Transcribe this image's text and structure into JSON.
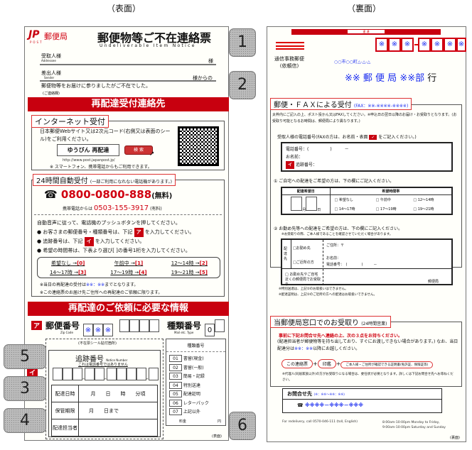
{
  "labels": {
    "front": "（表面）",
    "back": "（裏面）"
  },
  "front": {
    "logo": "JP",
    "logo_sub": "POST",
    "brand": "郵便局",
    "title": "郵便物等ご不在連絡票",
    "subtitle": "Undeliverable Item Notice",
    "addressee": "受取人様",
    "addressee_en": "Addressee",
    "addressee_suffix": "様",
    "sender": "差出人様",
    "sender_en": "Sender",
    "sender_suffix": "様からの",
    "message": "郵便物等をお届けに参りましたがご不在でした。",
    "contact_note": "(ご連絡欄)",
    "band1": "再配達受付連絡先",
    "internet": {
      "title": "インターネット受付",
      "desc": "日本郵便Webサイト又は2次元コード(右側又は表面のシール)をご利用ください。",
      "search_term": "ゆうびん 再配達",
      "search_button": "検 索",
      "url": "http://www.post.japanpost.jp/",
      "note": "※ スマートフォン、携帯電話からもご利用できます。"
    },
    "auto": {
      "title": "24時間自動受付",
      "title_note": "(一部ご利用になれない電話機があります。)",
      "phone_icon": "☎",
      "phone": "0800-0800-888",
      "phone_free": "(無料)",
      "mobile_label": "携帯電話からは",
      "mobile": "0503-155-3917",
      "mobile_paid": "(有料)",
      "lines": [
        "自動音声に従って、電話機のプッシュボタンを押してください。"
      ],
      "bullet1a": "お客さまの郵便番号・種類番号は、下記",
      "bullet1b": "を入力してください。",
      "bullet2a": "追跡番号は、下記",
      "bullet2b": "を入力してください。",
      "bullet3": "希望の時間帯は、下表より選び[ ]の番号1桁を入力してください。",
      "times": [
        {
          "t": "希望なし →",
          "n": "[0]"
        },
        {
          "t": "午前中 →",
          "n": "[1]"
        },
        {
          "t": "12〜14時 →",
          "n": "[2]"
        },
        {
          "t": "14〜17時 →",
          "n": "[3]"
        },
        {
          "t": "17〜19時 →",
          "n": "[4]"
        },
        {
          "t": "19〜21時 →",
          "n": "[5]"
        }
      ],
      "note1a": "※当日の再配達の受付は",
      "note1b": "※※：※※",
      "note1c": "までとなります。",
      "note2": "※この連絡票のお届け先ご住所への再配達のご依頼に限ります。"
    },
    "band2": "再配達のご依頼に必要な情報",
    "tag_a": "ア",
    "tag_i": "イ",
    "zip": {
      "label": "郵便番号",
      "en": "Zip Code",
      "cells": [
        "※",
        "※",
        "※"
      ]
    },
    "type": {
      "label": "種類番号",
      "en": "Mail etc. Type",
      "value": "0"
    },
    "seal_note": "(不在票シール貼付箇所)",
    "tracking": {
      "label": "追跡番号",
      "en": "Notice Number",
      "note": "これは電話番号ではありません"
    },
    "rows": [
      {
        "label": "配達日時",
        "value": "月　　日　　時　　分頃"
      },
      {
        "label": "保管期限",
        "value": "月　　日まで"
      },
      {
        "label": "配達担当者",
        "value": ""
      }
    ],
    "types_title": "種類番号",
    "types": [
      {
        "code": "01",
        "name": "書留(現金)"
      },
      {
        "code": "02",
        "name": "書留(一般)"
      },
      {
        "code": "03",
        "name": "簡易・記録"
      },
      {
        "code": "04",
        "name": "特別送達"
      },
      {
        "code": "05",
        "name": "配達証明"
      },
      {
        "code": "06",
        "name": "レターパック"
      },
      {
        "code": "07",
        "name": "上記以外"
      }
    ],
    "fee_label": "料金",
    "fee_unit": "円",
    "side": "(表面)"
  },
  "callouts": [
    "1",
    "2",
    "3",
    "4",
    "5",
    "6"
  ],
  "back": {
    "top_bar": "速 達",
    "postal": [
      "※",
      "※",
      "※",
      "※",
      "※",
      "※",
      "※"
    ],
    "mail_type": "通信事務郵便",
    "mail_type2": "(依頼信)",
    "address": "○○市○○町△-△-△",
    "office": "※※ 郵 便 局",
    "dept": "※※部",
    "to": "行",
    "fax": {
      "title": "郵便・ＦＡＸによる受付",
      "fax_no": "(FAX：※※-※※※※-※※※※)",
      "desc": "太枠内にご記入の上、ポスト投かん又はFAXしてください。※申込日の翌日以降のお届け・お受取りとなります。(お受取り可能となるお時間は、郵便局により異なります。)",
      "phone_title_a": "受取人様の電話番号(FAXの方は、お名前・表面",
      "phone_title_b": "をご記入ください。)",
      "check": "✓",
      "phone": "電話番号：(　　　　　)　　　－",
      "name": "お名前：",
      "tracking": "追跡番号：",
      "q1": "① ご自宅への配達をご希望の方は、下の欄にご記入ください。",
      "date_h": "配達希望日",
      "time_h": "希望時間帯",
      "month": "月",
      "day": "日",
      "slots": [
        "□ 希望なし",
        "□ 午前中",
        "□ 12〜14時",
        "□ 14〜17時",
        "□ 17〜19時",
        "□ 19〜21時"
      ],
      "q2": "② お勤め先等への配達をご希望の方は、下の欄にご記入ください。",
      "q2_note": "※お受取りの際、ご本人様であることを確認させていただく場合があります。",
      "dest": "配達先",
      "opt1": "□お勤め先",
      "opt2": "□ご近所の方",
      "addr": "ご住所：〒",
      "name2": "お名前：",
      "tel2": "電話番号：　(　　　　)　　　－",
      "opt3": "□ お勤め先やご自宅近くの郵便局でお受取り",
      "post_office": "郵便局",
      "note1": "※特別送達は、上記②のお取扱いはできません。",
      "note2": "※配達証明は、上記②のご近所の方への配達はお取扱いできません。"
    },
    "window": {
      "title": "当郵便局窓口でのお受取り",
      "hours": "(24時間営業)",
      "red": "事前に下記お問合せ先へ連絡の上、次の３点をお持ちください。",
      "desc_a": "(配達担当者が郵便物等を持ち出しており、すぐにお渡しできない場合があります。) なお、当日配達分は",
      "desc_time": "※※：※※",
      "desc_b": "以降にお越しください。",
      "items": [
        "この連絡票",
        "印鑑",
        "ご本人様・ご住所が確認できる証明書(免許証、保険証等)"
      ],
      "plus": "+",
      "proxy": "※代理人(同居家族以外)の方がお受取りになる場合は、委任状が必要となります。詳しくは下記お問合せ先へお尋ねください。"
    },
    "inquiry": {
      "title": "お問合せ先",
      "hours": "(※：※※〜※※：※※)",
      "icon": "☎",
      "phone": "※※※※－※※※－※※※"
    },
    "english": "For redelivery,  call 0570-046-111  (toll, English)",
    "hours_en1": "8:00am-10:00pm  Monday to Friday,",
    "hours_en2": "9:00am-10:00pm  Saturday and Sunday",
    "side": "(裏面)"
  }
}
